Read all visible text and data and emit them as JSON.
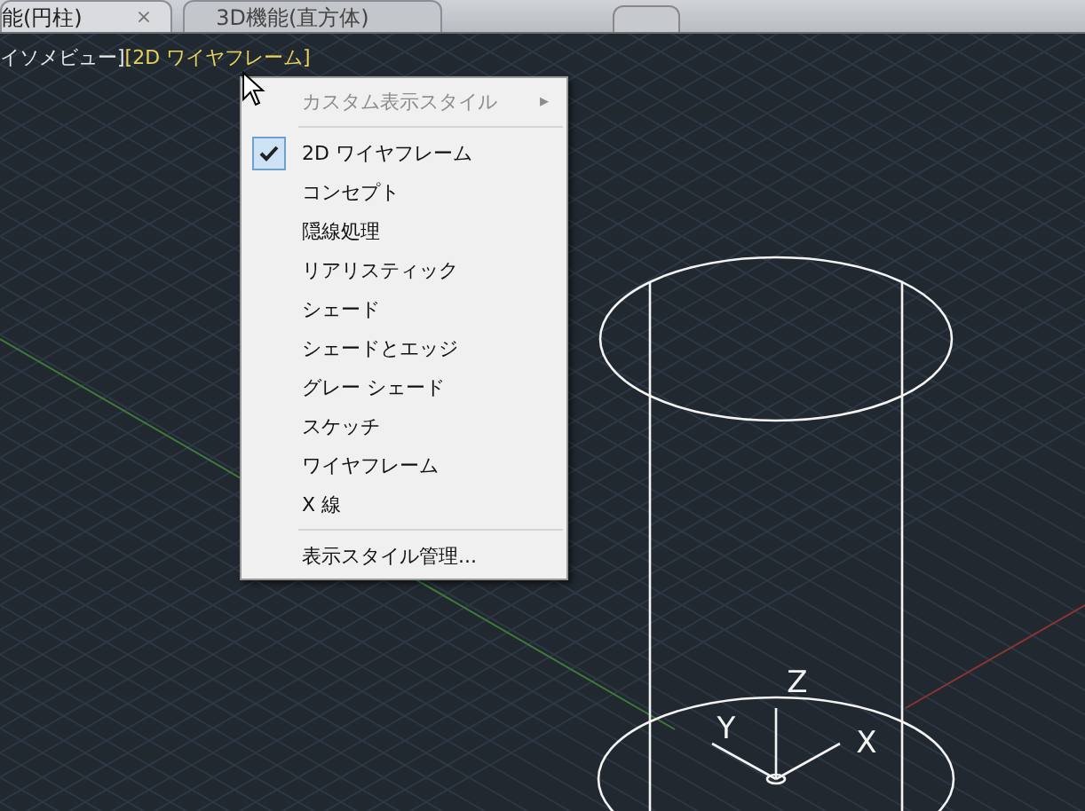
{
  "tabs": [
    {
      "label": "能(円柱)",
      "selected": true,
      "close": "×"
    },
    {
      "label": "3D機能(直方体)",
      "selected": false
    }
  ],
  "viewport": {
    "view_label": "イソメビュー]",
    "visual_style_label": "[2D ワイヤフレーム]",
    "ucs_axes": [
      "Z",
      "Y",
      "X"
    ]
  },
  "context_menu": {
    "items": [
      {
        "kind": "submenu",
        "label": "カスタム表示スタイル",
        "disabled": true,
        "arrow": "▸"
      },
      {
        "kind": "separator"
      },
      {
        "kind": "item",
        "label": "2D ワイヤフレーム",
        "checked": true
      },
      {
        "kind": "item",
        "label": "コンセプト",
        "checked": false
      },
      {
        "kind": "item",
        "label": "隠線処理",
        "checked": false
      },
      {
        "kind": "item",
        "label": "リアリスティック",
        "checked": false
      },
      {
        "kind": "item",
        "label": "シェード",
        "checked": false
      },
      {
        "kind": "item",
        "label": "シェードとエッジ",
        "checked": false
      },
      {
        "kind": "item",
        "label": "グレー シェード",
        "checked": false
      },
      {
        "kind": "item",
        "label": "スケッチ",
        "checked": false
      },
      {
        "kind": "item",
        "label": "ワイヤフレーム",
        "checked": false
      },
      {
        "kind": "item",
        "label": "X 線",
        "checked": false
      },
      {
        "kind": "separator"
      },
      {
        "kind": "item",
        "label": "表示スタイル管理...",
        "checked": false
      }
    ]
  }
}
